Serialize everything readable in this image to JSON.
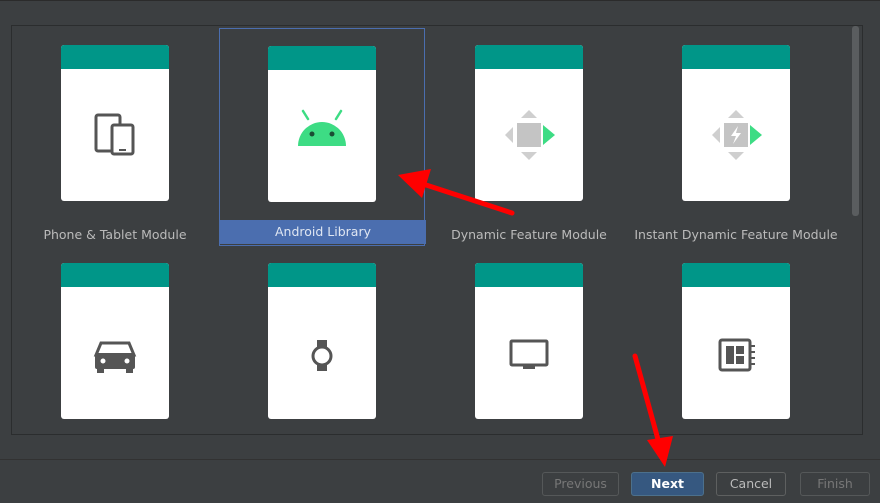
{
  "modules": [
    {
      "label": "Phone & Tablet Module",
      "icon": "phone-tablet-icon"
    },
    {
      "label": "Android Library",
      "icon": "android-icon",
      "selected": true
    },
    {
      "label": "Dynamic Feature Module",
      "icon": "dynamic-feature-icon"
    },
    {
      "label": "Instant Dynamic Feature Module",
      "icon": "instant-dynamic-feature-icon"
    },
    {
      "label": "",
      "icon": "car-icon"
    },
    {
      "label": "",
      "icon": "watch-icon"
    },
    {
      "label": "",
      "icon": "tv-icon"
    },
    {
      "label": "",
      "icon": "things-board-icon"
    }
  ],
  "buttons": {
    "previous": "Previous",
    "next": "Next",
    "cancel": "Cancel",
    "finish": "Finish"
  },
  "colors": {
    "card_band": "#009688",
    "selection": "#4b6eaf",
    "android_green": "#3ddc84",
    "annotation_arrow": "#ff0000"
  }
}
